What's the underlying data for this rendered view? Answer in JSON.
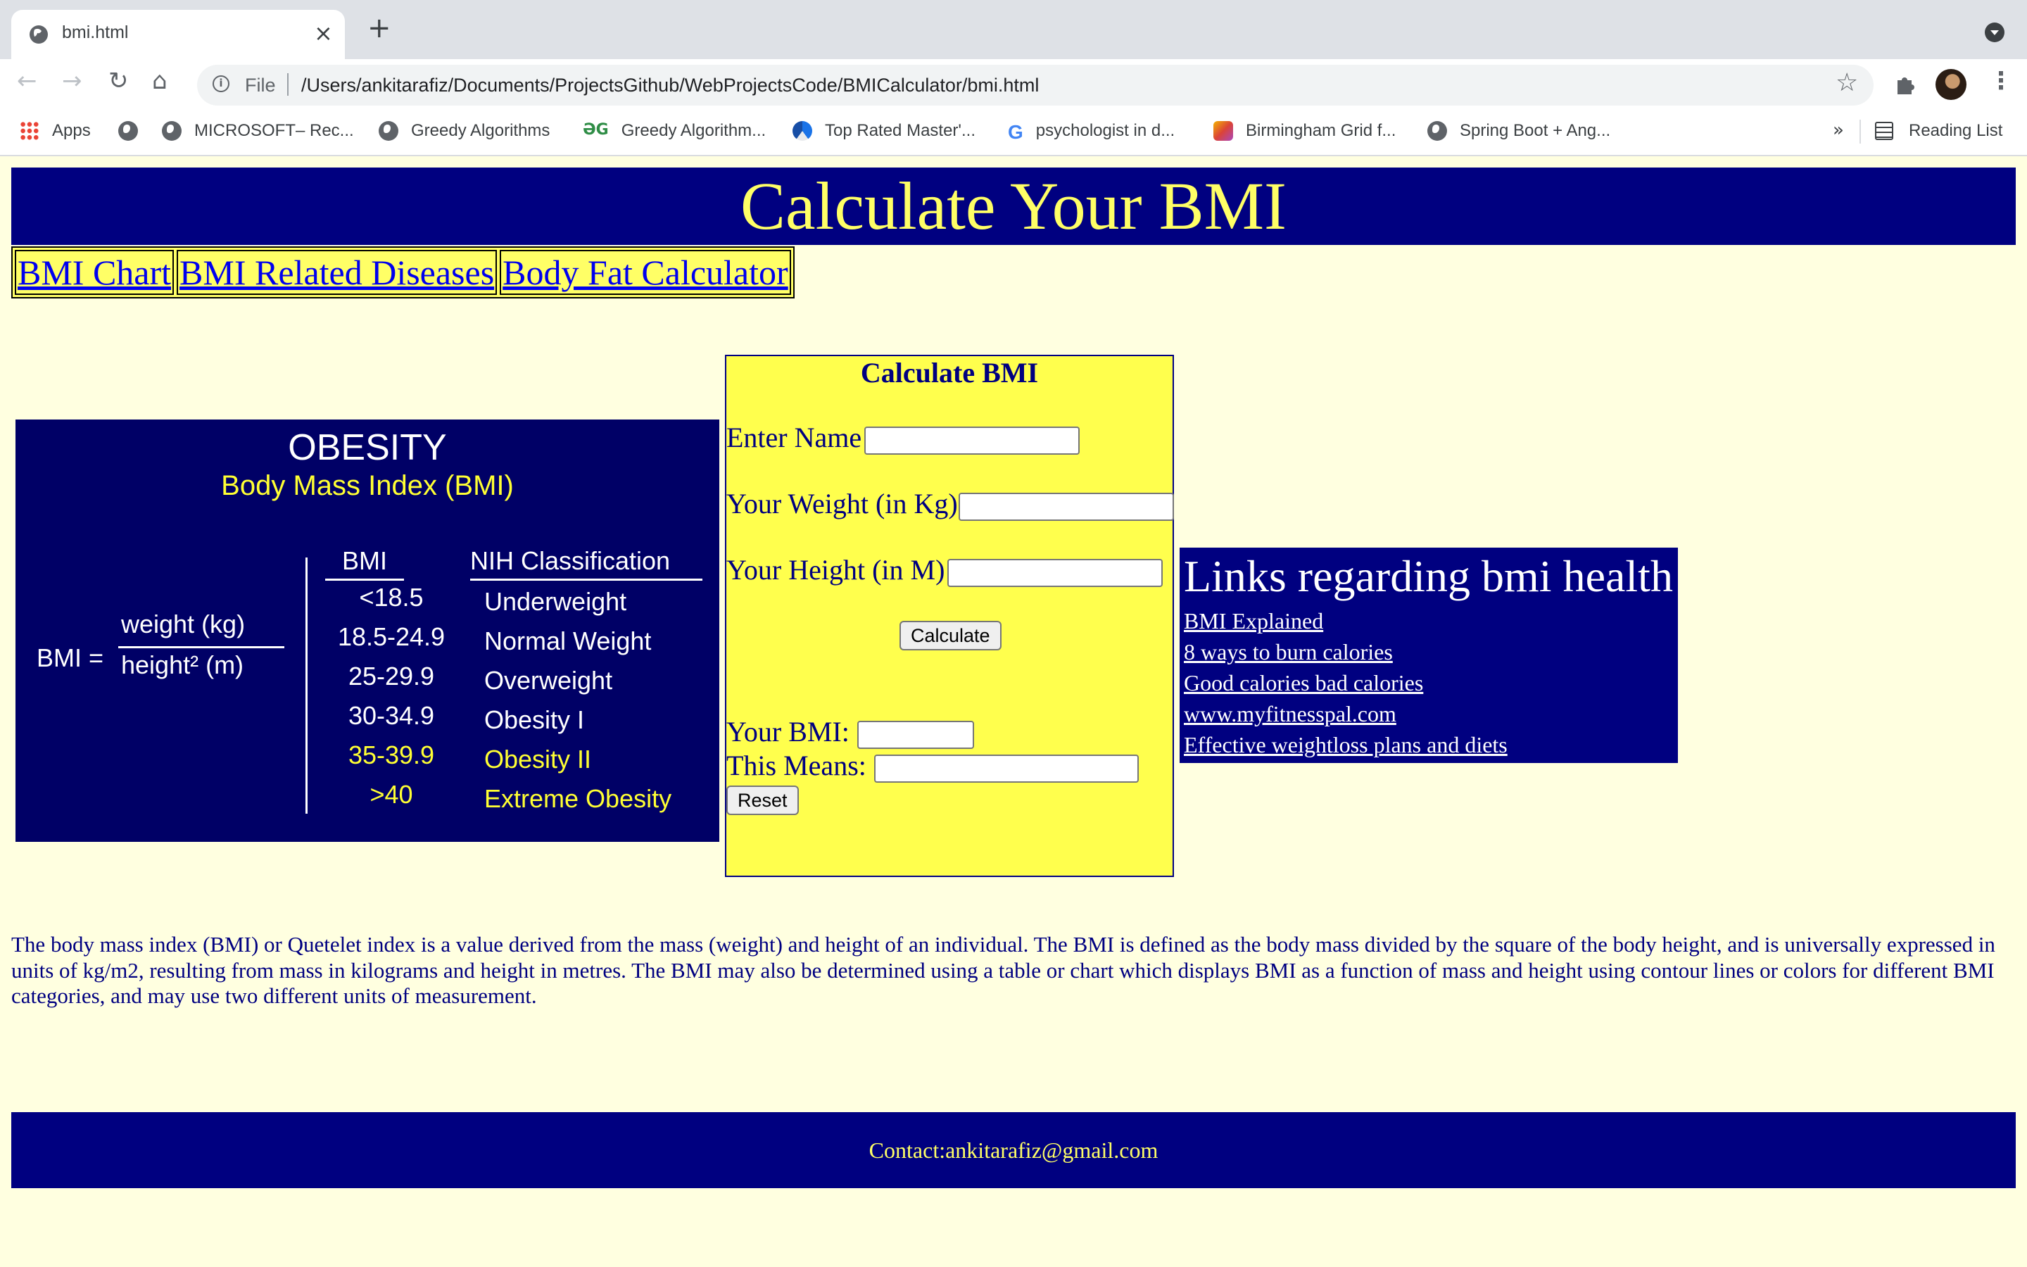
{
  "browser": {
    "tab": {
      "title": "bmi.html"
    },
    "address_bar": {
      "scheme_label": "File",
      "url": "/Users/ankitarafiz/Documents/ProjectsGithub/WebProjectsCode/BMICalculator/bmi.html"
    },
    "bookmarks": [
      {
        "label": "Apps",
        "icon": "apps-grid-icon"
      },
      {
        "label": "",
        "icon": "globe-icon"
      },
      {
        "label": "MICROSOFT– Rec...",
        "icon": "globe-icon"
      },
      {
        "label": "Greedy Algorithms",
        "icon": "globe-icon"
      },
      {
        "label": "Greedy Algorithm...",
        "icon": "geeksforgeeks-icon"
      },
      {
        "label": "Top Rated Master'...",
        "icon": "mastery-icon"
      },
      {
        "label": "psychologist in d...",
        "icon": "google-icon"
      },
      {
        "label": "Birmingham Grid f...",
        "icon": "birmingham-icon"
      },
      {
        "label": "Spring Boot + Ang...",
        "icon": "globe-icon"
      }
    ],
    "overflow_label": "»",
    "reading_list_label": "Reading List"
  },
  "page": {
    "header_title": "Calculate Your BMI",
    "nav_links": [
      "BMI Chart",
      "BMI Related Diseases",
      "Body Fat Calculator"
    ],
    "chart_image": {
      "title": "OBESITY",
      "subtitle": "Body Mass Index (BMI)",
      "formula_lhs": "BMI =",
      "formula_numerator": "weight (kg)",
      "formula_denominator": "height² (m)",
      "col_bmi": "BMI",
      "col_class": "NIH Classification",
      "rows": [
        {
          "bmi": "<18.5",
          "class": "Underweight",
          "color": "#ffffff"
        },
        {
          "bmi": "18.5-24.9",
          "class": "Normal Weight",
          "color": "#ffffff"
        },
        {
          "bmi": "25-29.9",
          "class": "Overweight",
          "color": "#ffffff"
        },
        {
          "bmi": "30-34.9",
          "class": "Obesity I",
          "color": "#ffffff"
        },
        {
          "bmi": "35-39.9",
          "class": "Obesity II",
          "color": "#ffff33"
        },
        {
          "bmi": ">40",
          "class": "Extreme Obesity",
          "color": "#ffff33"
        }
      ]
    },
    "calculator": {
      "heading": "Calculate BMI",
      "name_label": "Enter Name",
      "weight_label": "Your Weight (in Kg)",
      "height_label": "Your Height (in M)",
      "calculate_label": "Calculate",
      "bmi_label": "Your BMI:",
      "means_label": "This Means:",
      "reset_label": "Reset",
      "name_value": "",
      "weight_value": "",
      "height_value": "",
      "bmi_value": "",
      "means_value": ""
    },
    "links_panel": {
      "heading": "Links regarding bmi health",
      "links": [
        "BMI Explained",
        "8 ways to burn calories",
        "Good calories bad calories",
        "www.myfitnesspal.com",
        "Effective weightloss plans and diets"
      ]
    },
    "description": "The body mass index (BMI) or Quetelet index is a value derived from the mass (weight) and height of an individual. The BMI is defined as the body mass divided by the square of the body height, and is universally expressed in units of kg/m2, resulting from mass in kilograms and height in metres. The BMI may also be determined using a table or chart which displays BMI as a function of mass and height using contour lines or colors for different BMI categories, and may use two different units of measurement.",
    "footer_contact": "Contact:ankitarafiz@gmail.com"
  },
  "colors": {
    "navy": "#000080",
    "page_bg": "#ffffe0",
    "header_text": "#ffff66",
    "calc_bg": "#ffff4d",
    "link_blue": "#0000ee"
  }
}
